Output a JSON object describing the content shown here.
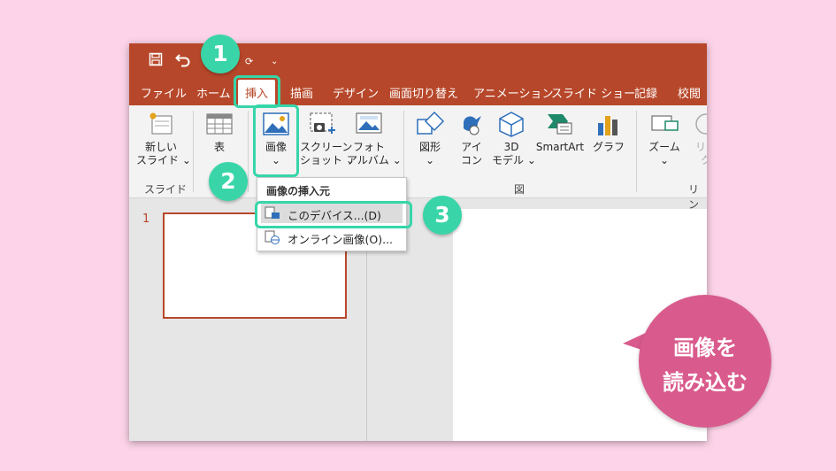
{
  "qat": {
    "save_icon": "save-icon",
    "undo_icon": "undo-icon",
    "more": "⌄"
  },
  "tabs": [
    "ファイル",
    "ホーム",
    "挿入",
    "描画",
    "デザイン",
    "画面切り替え",
    "アニメーション",
    "スライド ショー",
    "記録",
    "校閲"
  ],
  "active_tab": "挿入",
  "ribbon": {
    "new_slide": [
      "新しい",
      "スライド ⌄"
    ],
    "table": "表",
    "picture": [
      "画像",
      "⌄"
    ],
    "screenshot": [
      "スクリーン",
      "ショット ⌄"
    ],
    "photo_album": [
      "フォト",
      "アルバム ⌄"
    ],
    "shapes": [
      "図形",
      "⌄"
    ],
    "icons": [
      "アイ",
      "コン"
    ],
    "models3d": [
      "3D",
      "モデル ⌄"
    ],
    "smartart": "SmartArt",
    "chart": "グラフ",
    "zoom": [
      "ズーム",
      "⌄"
    ],
    "link": [
      "リン",
      "ク"
    ],
    "groups": {
      "slides": "スライド",
      "illustrations": "図",
      "links": "リン"
    }
  },
  "menu": {
    "header": "画像の挿入元",
    "items": [
      "このデバイス...(D)",
      "オンライン画像(O)..."
    ]
  },
  "thumbnail_number": "1",
  "steps": [
    "1",
    "2",
    "3"
  ],
  "callout": [
    "画像を",
    "読み込む"
  ],
  "colors": {
    "accent": "#b7472a",
    "highlight": "#35d6a9",
    "callout": "#d95b8d",
    "background": "#fcd3e8"
  }
}
